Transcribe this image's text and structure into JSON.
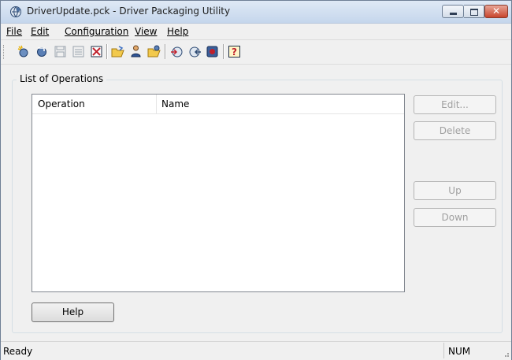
{
  "window": {
    "title": "DriverUpdate.pck - Driver Packaging Utility",
    "app_icon": "gear-globe-icon"
  },
  "menu": [
    {
      "label": "File",
      "mnemonic_index": 0
    },
    {
      "label": "Edit",
      "mnemonic_index": 0
    },
    {
      "label": "Configuration",
      "mnemonic_index": 0
    },
    {
      "label": "View",
      "mnemonic_index": 0
    },
    {
      "label": "Help",
      "mnemonic_index": 0
    }
  ],
  "toolbar": {
    "buttons": [
      {
        "icon": "new-package-icon",
        "enabled": true
      },
      {
        "icon": "open-package-icon",
        "enabled": true
      },
      {
        "icon": "save-icon",
        "enabled": false
      },
      {
        "icon": "save-as-icon",
        "enabled": false
      },
      {
        "icon": "close-package-icon",
        "enabled": true
      },
      {
        "icon": "open-folder-icon",
        "enabled": true
      },
      {
        "icon": "user-icon",
        "enabled": true
      },
      {
        "icon": "folder-gear-icon",
        "enabled": true
      },
      {
        "icon": "add-operation-icon",
        "enabled": true
      },
      {
        "icon": "remove-operation-icon",
        "enabled": true
      },
      {
        "icon": "build-icon",
        "enabled": true
      },
      {
        "icon": "help-icon",
        "enabled": true
      }
    ]
  },
  "operations": {
    "group_label": "List of Operations",
    "columns": [
      "Operation",
      "Name"
    ],
    "rows": []
  },
  "buttons": {
    "edit": "Edit...",
    "delete": "Delete",
    "up": "Up",
    "down": "Down",
    "help": "Help"
  },
  "status": {
    "text": "Ready",
    "num": "NUM"
  },
  "colors": {
    "disabled_text": "#a0a0a0",
    "frame": "#f0f0f0",
    "title_gradient_top": "#dfe9f5",
    "close_button": "#c8452d"
  }
}
